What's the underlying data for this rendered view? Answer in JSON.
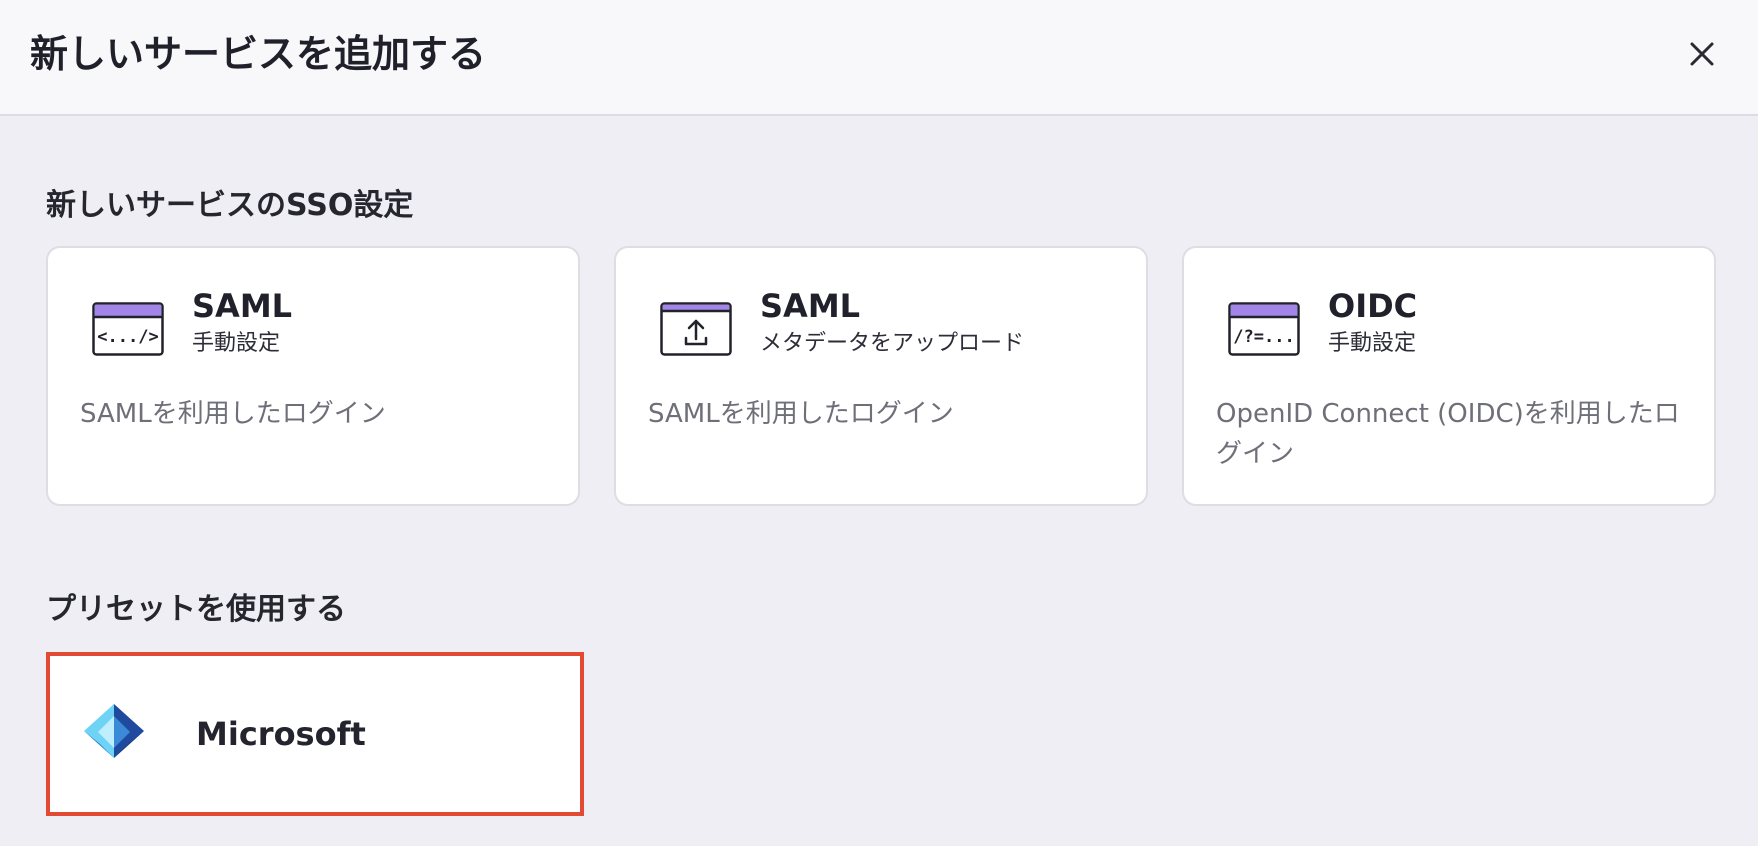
{
  "modal": {
    "title": "新しいサービスを追加する",
    "close_icon": "close-icon"
  },
  "sso_section": {
    "title": "新しいサービスのSSO設定",
    "cards": [
      {
        "icon": "code-window-icon",
        "icon_text": "<.../>",
        "title": "SAML",
        "subtitle": "手動設定",
        "description": "SAMLを利用したログイン"
      },
      {
        "icon": "upload-window-icon",
        "title": "SAML",
        "subtitle": "メタデータをアップロード",
        "description": "SAMLを利用したログイン"
      },
      {
        "icon": "query-window-icon",
        "icon_text": "/?=...",
        "title": "OIDC",
        "subtitle": "手動設定",
        "description": "OpenID Connect (OIDC)を利用したログイン"
      }
    ]
  },
  "preset_section": {
    "title": "プリセットを使用する",
    "presets": [
      {
        "icon": "microsoft-entra-icon",
        "label": "Microsoft"
      }
    ]
  },
  "colors": {
    "accent_purple": "#a385ea",
    "selected_border": "#e24a33",
    "header_bg": "#f8f8fb",
    "page_bg": "#efeef4"
  }
}
